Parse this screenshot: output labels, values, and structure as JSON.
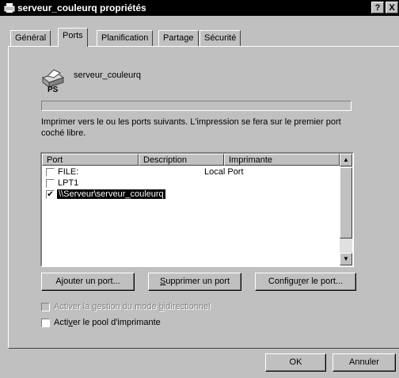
{
  "window": {
    "title": "serveur_couleurq propriétés",
    "help_btn": "?",
    "close_btn": "X"
  },
  "tabs": [
    {
      "label": "Général"
    },
    {
      "label": "Ports"
    },
    {
      "label": "Planification"
    },
    {
      "label": "Partage"
    },
    {
      "label": "Sécurité"
    }
  ],
  "printer": {
    "name": "serveur_couleurq",
    "icon_badge": "PS"
  },
  "description": "Imprimer vers le ou les ports suivants. L'impression se fera sur le premier port coché libre.",
  "ports_table": {
    "headers": [
      "Port",
      "Description",
      "Imprimante"
    ],
    "rows": [
      {
        "port": "FILE:",
        "description": "Local Port",
        "printer": "",
        "checked": "☐"
      },
      {
        "port": "LPT1",
        "description": "",
        "printer": "",
        "checked": "☐"
      },
      {
        "port": "\\\\Serveur\\serveur_couleurq",
        "description": "",
        "printer": "",
        "checked": "✔"
      }
    ]
  },
  "buttons": {
    "add_port": {
      "pre": "A",
      "key": "j",
      "post": "outer un port..."
    },
    "delete_port": {
      "pre": "",
      "key": "S",
      "post": "upprimer un port"
    },
    "configure_port": {
      "pre": "Configu",
      "key": "r",
      "post": "er le port..."
    },
    "ok": "OK",
    "cancel": "Annuler"
  },
  "options": {
    "bidirectional": {
      "pre": "Activer la gestion du mode ",
      "key": "b",
      "post": "idirectionnel",
      "checked": "",
      "enabled": "false"
    },
    "pool": {
      "pre": "Acti",
      "key": "v",
      "post": "er le pool d'imprimante",
      "checked": ""
    }
  },
  "colors": {
    "window_bg": "#c0c0c0",
    "selection": "#000000",
    "titlebar": "#000000"
  }
}
